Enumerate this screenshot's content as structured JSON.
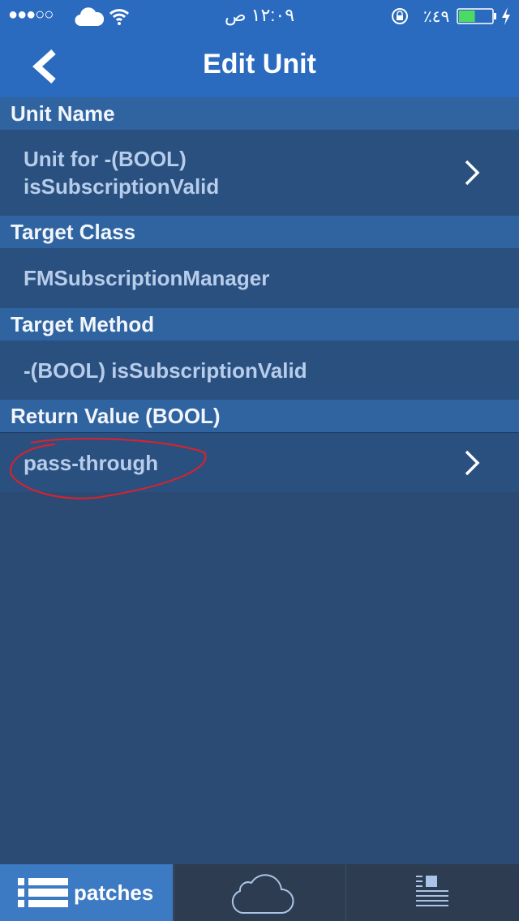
{
  "status_bar": {
    "signal": "●●●○○",
    "time": "١٢:٠٩ ص",
    "battery_percent": "٪٤٩",
    "battery_level": 49,
    "icons": [
      "cloud-icon",
      "wifi-icon",
      "rotation-lock-icon",
      "battery-icon",
      "charging-icon"
    ]
  },
  "nav": {
    "title": "Edit Unit",
    "back_icon": "chevron-left-icon"
  },
  "sections": [
    {
      "header": "Unit Name",
      "value_line1": "Unit for -(BOOL)",
      "value_line2": "isSubscriptionValid"
    },
    {
      "header": "Target Class",
      "value": "FMSubscriptionManager"
    },
    {
      "header": "Target Method",
      "value": "-(BOOL) isSubscriptionValid"
    },
    {
      "header": "Return Value (BOOL)",
      "value": "pass-through"
    }
  ],
  "tabs": [
    {
      "label": "patches",
      "icon": "list-icon",
      "active": true
    },
    {
      "icon": "cloud-icon"
    },
    {
      "icon": "document-icon"
    }
  ],
  "colors": {
    "nav": "#2a6bc0",
    "header": "#2f64a0",
    "row": "#2a5080",
    "background": "#2b4b74",
    "tab_active": "#3c7ac4",
    "annotation": "#e0202a",
    "battery": "#4cd964"
  }
}
